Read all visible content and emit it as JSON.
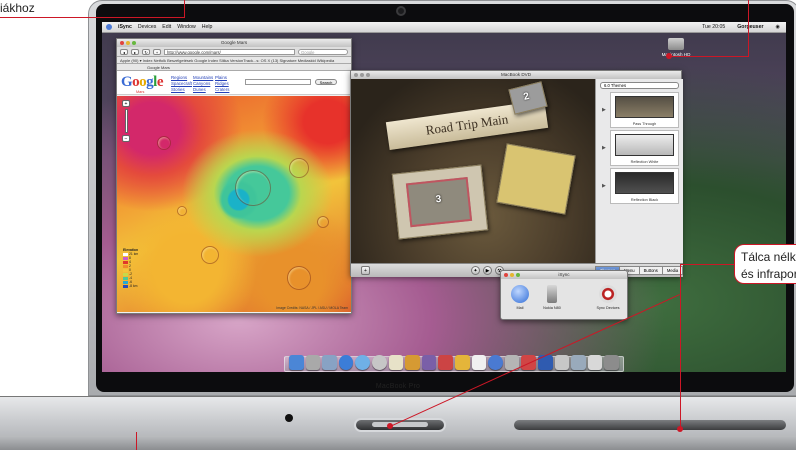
{
  "callouts": {
    "top_left_text": "iákhoz",
    "right_box_line1": "Tálca nélkü",
    "right_box_line2": "és infrapor"
  },
  "laptop": {
    "brand": "MacBook Pro"
  },
  "menubar": {
    "app": "iSync",
    "items": [
      "Devices",
      "Edit",
      "Window",
      "Help"
    ],
    "clock": "Tue 20:05",
    "user": "Gorgeuser"
  },
  "desktop": {
    "hd_label": "Macintosh HD"
  },
  "browser": {
    "title": "Google Mars",
    "url": "http://www.google.com/mars/",
    "search_placeholder": "Google",
    "bookmarks": "Apple (90) ▾  Index Netfolk  Beszélgetések  Google  Index  Sliika  VersionTrack...s: OS X (13)  Signature  Mediaskid  Wikipedia",
    "tab_label": "Google Mars",
    "logo_sub": "Mars",
    "nav_links": [
      "Regions",
      "Mountains",
      "Plains",
      "Spacecraft",
      "Canyons",
      "Ridges",
      "Stories",
      "Dunes",
      "Craters"
    ],
    "search_button": "Search",
    "legend_title": "Elevation",
    "legend_values": [
      "21 km",
      "8",
      "4",
      "2",
      "0",
      "-2",
      "-4",
      "-6",
      "-8 km"
    ],
    "legend_colors": [
      "#ffffff",
      "#c95cc9",
      "#e0372b",
      "#f08a2c",
      "#f2c33b",
      "#c7d94a",
      "#4ec896",
      "#27a9d0",
      "#2a4bb8"
    ],
    "attribution": "Image Credits: NASA / JPL / ASU / MOLA Team"
  },
  "dvd": {
    "title": "MacBook DVD",
    "menu_title": "Road Trip Main",
    "drop_zone_1": "2",
    "drop_zone_2": "3",
    "theme_dropdown": "6.0 Themes",
    "themes": [
      "Pass Through",
      "Reflection White",
      "Reflection Black"
    ],
    "tabs": [
      "Themes",
      "Menu",
      "Buttons",
      "Media"
    ]
  },
  "isync": {
    "title": "iSync",
    "devices": [
      "Mail",
      "Nokia N80",
      "Sync Devices"
    ]
  }
}
